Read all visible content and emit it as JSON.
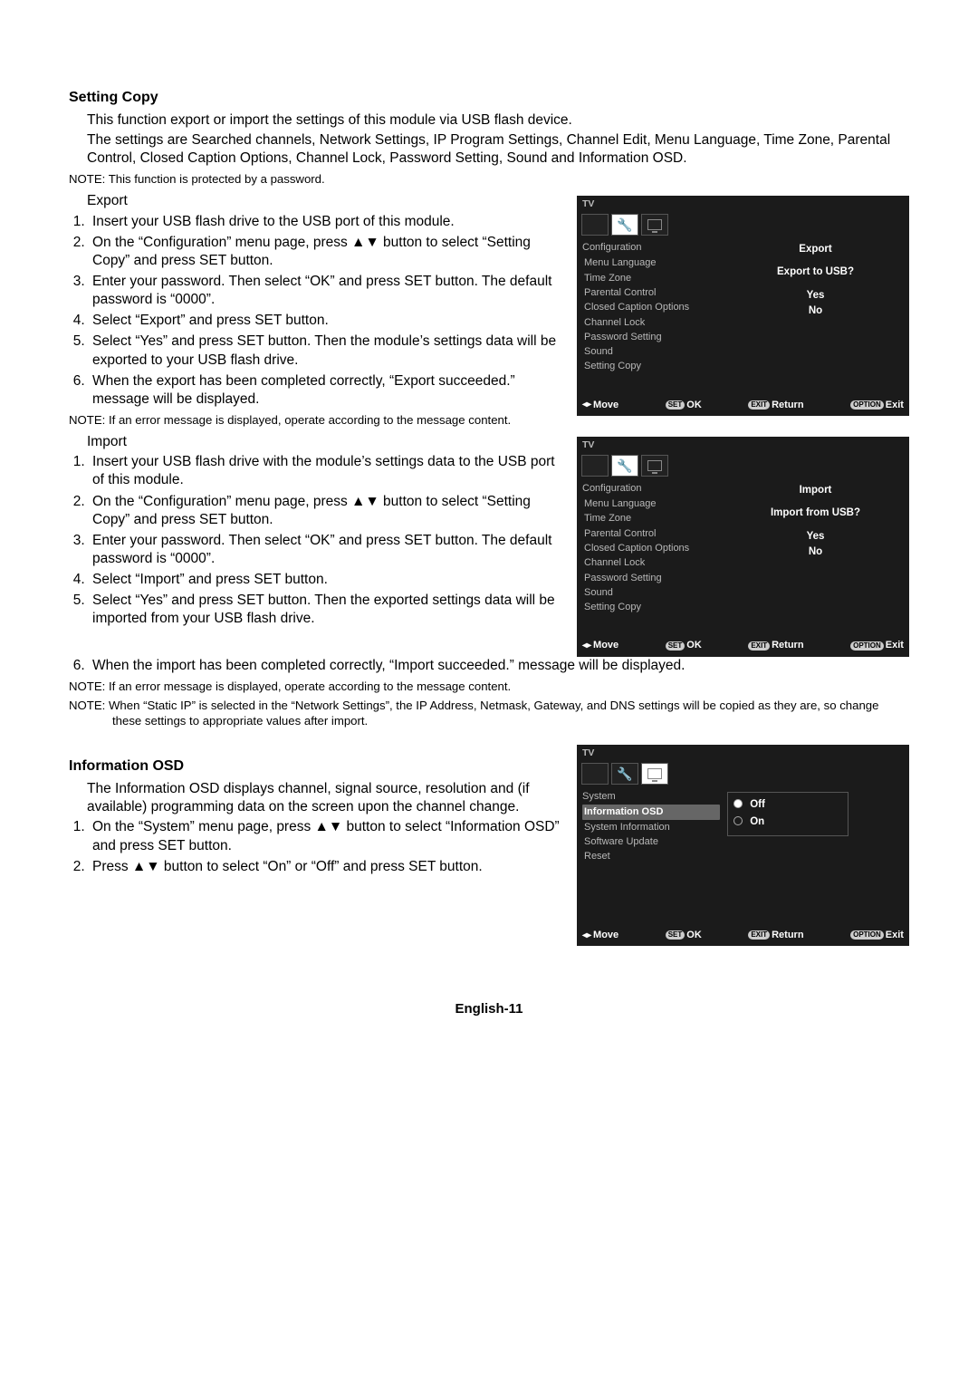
{
  "settingCopy": {
    "title": "Setting Copy",
    "intro1": "This function export or import the settings of this module via USB flash device.",
    "intro2": "The settings are Searched channels, Network Settings, IP Program Settings, Channel Edit, Menu Language, Time Zone, Parental Control, Closed Caption Options, Channel Lock, Password Setting, Sound and Information OSD.",
    "note1": "NOTE:  This function is protected by a password.",
    "exportTitle": "Export",
    "exportSteps": [
      "Insert your USB flash drive to the USB port of this module.",
      "On the “Configuration” menu page, press ▲▼ button to select “Setting Copy” and press SET button.",
      "Enter your password. Then select “OK” and press SET button. The default password is “0000”.",
      "Select “Export” and press SET button.",
      "Select “Yes” and press SET button. Then the module’s settings data will be exported to your USB flash drive.",
      "When the export has been completed correctly, “Export succeeded.” message will be displayed."
    ],
    "note2": "NOTE:  If an error message is displayed, operate according to the message content.",
    "importTitle": "Import",
    "importSteps": [
      "Insert your USB flash drive with the module’s settings data to the USB port of this module.",
      "On the “Configuration” menu page, press ▲▼ button to select “Setting Copy” and press SET button.",
      "Enter your password. Then select “OK” and press SET button. The default password is “0000”.",
      "Select “Import” and press SET button.",
      "Select “Yes” and press SET button. Then the exported settings data will be imported from your USB flash drive."
    ],
    "importStep6": "When the import has been completed correctly, “Import succeeded.” message will be displayed.",
    "note3": "NOTE:  If an error message is displayed, operate according to the message content.",
    "note4": "NOTE:  When “Static IP” is selected in the “Network Settings”, the IP Address, Netmask, Gateway, and DNS settings will be copied as they are, so change these settings to appropriate values after import."
  },
  "infoOSD": {
    "title": "Information OSD",
    "intro": "The Information OSD displays channel, signal source, resolution and (if available) programming data on the screen upon the channel change.",
    "steps": [
      "On the “System” menu page, press ▲▼ button to select “Information OSD” and press SET button.",
      "Press ▲▼ button to select “On” or “Off” and press SET button."
    ]
  },
  "osdCommon": {
    "tv": "TV",
    "footer": {
      "move": "Move",
      "ok": "OK",
      "ret": "Return",
      "exit": "Exit",
      "setLabel": "SET",
      "exitLabel": "EXIT",
      "optionLabel": "OPTION"
    }
  },
  "osd1": {
    "menuTitle": "Configuration",
    "items": [
      "Menu Language",
      "Time Zone",
      "Parental Control",
      "Closed Caption Options",
      "Channel Lock",
      "Password Setting",
      "Sound",
      "Setting Copy"
    ],
    "promptTitle": "Export",
    "promptSub": "Export to USB?",
    "yes": "Yes",
    "no": "No"
  },
  "osd2": {
    "menuTitle": "Configuration",
    "items": [
      "Menu Language",
      "Time Zone",
      "Parental Control",
      "Closed Caption Options",
      "Channel Lock",
      "Password Setting",
      "Sound",
      "Setting Copy"
    ],
    "promptTitle": "Import",
    "promptSub": "Import from USB?",
    "yes": "Yes",
    "no": "No"
  },
  "osd3": {
    "menuTitle": "System",
    "items": [
      "Information OSD",
      "System Information",
      "Software Update",
      "Reset"
    ],
    "highlight": 0,
    "opts": [
      "Off",
      "On"
    ],
    "selected": 0
  },
  "pageNum": "English-11"
}
